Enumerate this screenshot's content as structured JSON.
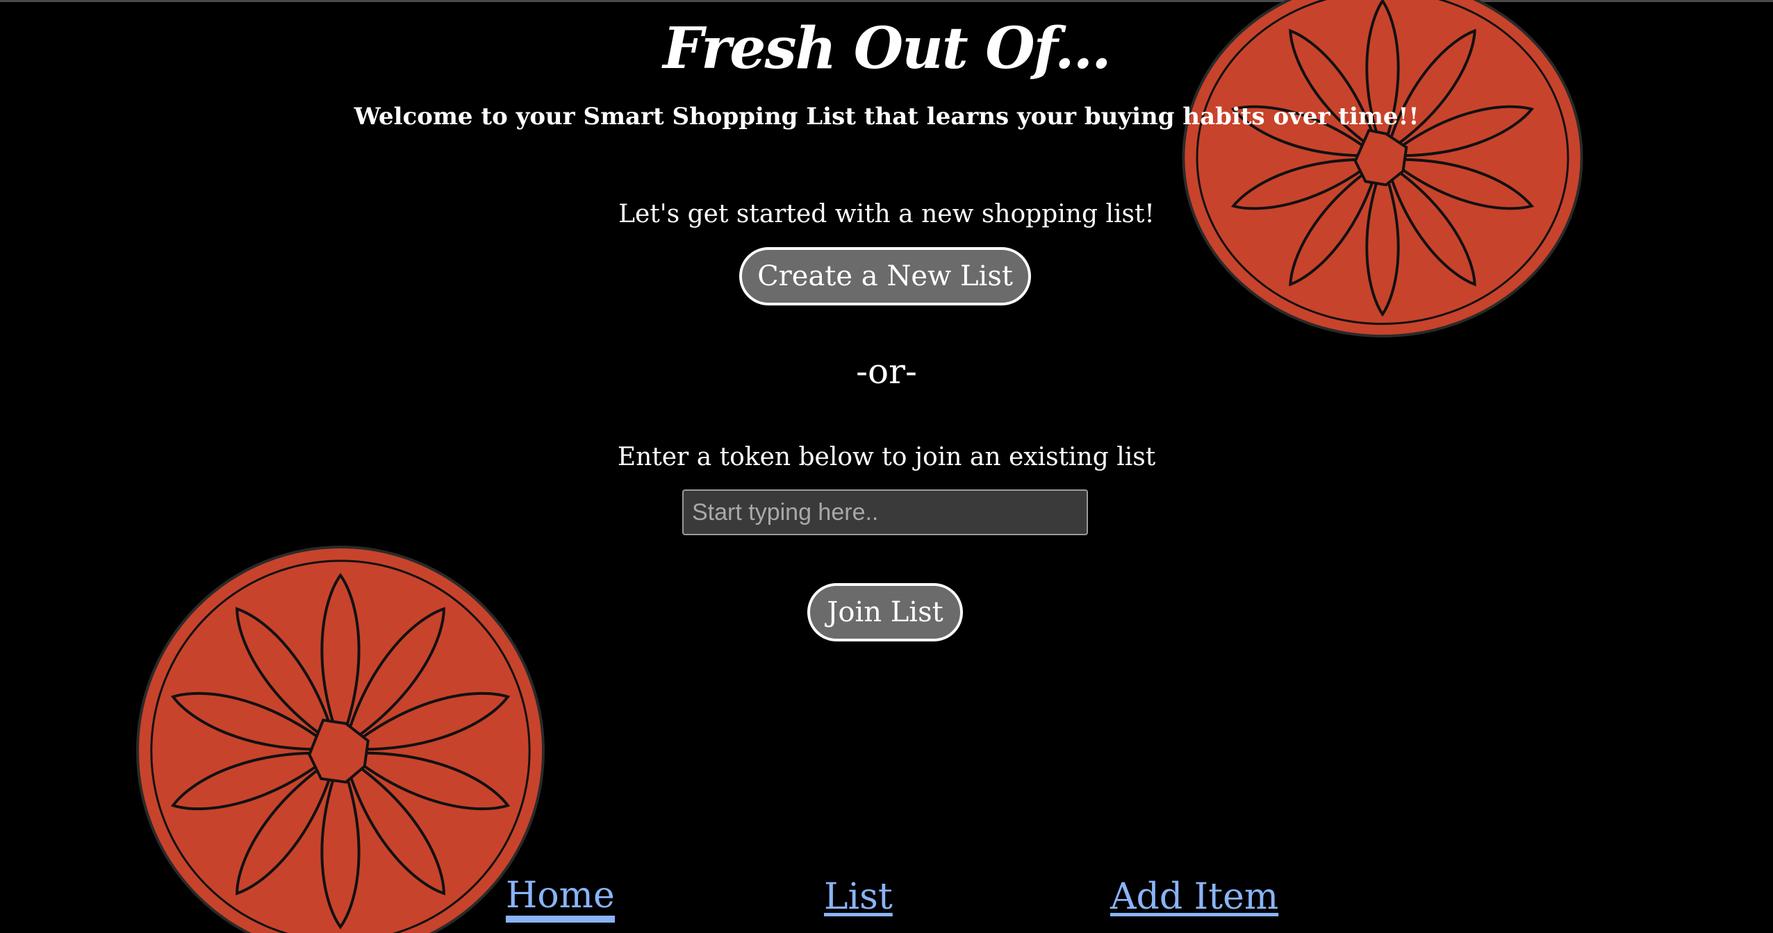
{
  "header": {
    "title": "Fresh Out Of...",
    "subtitle": "Welcome to your Smart Shopping List that learns your buying habits over time!!"
  },
  "create": {
    "prompt": "Let's get started with a new shopping list!",
    "button_label": "Create a New List"
  },
  "divider": "-or-",
  "join": {
    "prompt": "Enter a token below to join an existing list",
    "input_placeholder": "Start typing here..",
    "input_value": "",
    "button_label": "Join List"
  },
  "nav": {
    "items": [
      {
        "label": "Home",
        "active": true
      },
      {
        "label": "List",
        "active": false
      },
      {
        "label": "Add Item",
        "active": false
      }
    ]
  },
  "colors": {
    "background": "#000000",
    "orange_fill": "#c8432b",
    "button_bg": "#6b6b6b",
    "link": "#8ab4f8"
  },
  "decorations": {
    "top_right": "orange-slice-illustration",
    "bottom_left": "orange-slice-illustration"
  }
}
